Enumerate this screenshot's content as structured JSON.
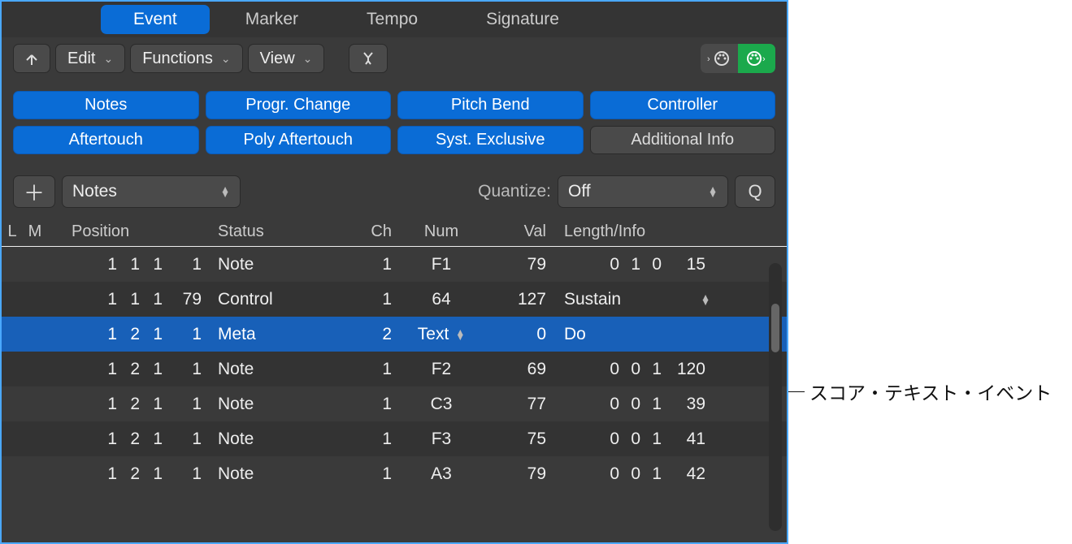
{
  "tabs": {
    "event": "Event",
    "marker": "Marker",
    "tempo": "Tempo",
    "signature": "Signature"
  },
  "toolbar": {
    "edit": "Edit",
    "functions": "Functions",
    "view": "View"
  },
  "filters": {
    "notes": "Notes",
    "progr_change": "Progr. Change",
    "pitch_bend": "Pitch Bend",
    "controller": "Controller",
    "aftertouch": "Aftertouch",
    "poly_aftertouch": "Poly Aftertouch",
    "syst_exclusive": "Syst. Exclusive",
    "additional_info": "Additional Info"
  },
  "control_row": {
    "type_select": "Notes",
    "quantize_label": "Quantize:",
    "quantize_value": "Off",
    "q_button": "Q"
  },
  "columns": {
    "l": "L",
    "m": "M",
    "position": "Position",
    "status": "Status",
    "ch": "Ch",
    "num": "Num",
    "val": "Val",
    "length_info": "Length/Info"
  },
  "rows": [
    {
      "pos": [
        "1",
        "1",
        "1",
        "1"
      ],
      "status": "Note",
      "ch": "1",
      "num": "F1",
      "val": "79",
      "len": [
        "0",
        "1",
        "0",
        "15"
      ],
      "info": "",
      "alt": false,
      "sel": false,
      "num_pop": false,
      "info_pop": false
    },
    {
      "pos": [
        "1",
        "1",
        "1",
        "79"
      ],
      "status": "Control",
      "ch": "1",
      "num": "64",
      "val": "127",
      "len": [],
      "info": "Sustain",
      "alt": true,
      "sel": false,
      "num_pop": false,
      "info_pop": true
    },
    {
      "pos": [
        "1",
        "2",
        "1",
        "1"
      ],
      "status": "Meta",
      "ch": "2",
      "num": "Text",
      "val": "0",
      "len": [],
      "info": "Do",
      "alt": false,
      "sel": true,
      "num_pop": true,
      "info_pop": false
    },
    {
      "pos": [
        "1",
        "2",
        "1",
        "1"
      ],
      "status": "Note",
      "ch": "1",
      "num": "F2",
      "val": "69",
      "len": [
        "0",
        "0",
        "1",
        "120"
      ],
      "info": "",
      "alt": true,
      "sel": false,
      "num_pop": false,
      "info_pop": false
    },
    {
      "pos": [
        "1",
        "2",
        "1",
        "1"
      ],
      "status": "Note",
      "ch": "1",
      "num": "C3",
      "val": "77",
      "len": [
        "0",
        "0",
        "1",
        "39"
      ],
      "info": "",
      "alt": false,
      "sel": false,
      "num_pop": false,
      "info_pop": false
    },
    {
      "pos": [
        "1",
        "2",
        "1",
        "1"
      ],
      "status": "Note",
      "ch": "1",
      "num": "F3",
      "val": "75",
      "len": [
        "0",
        "0",
        "1",
        "41"
      ],
      "info": "",
      "alt": true,
      "sel": false,
      "num_pop": false,
      "info_pop": false
    },
    {
      "pos": [
        "1",
        "2",
        "1",
        "1"
      ],
      "status": "Note",
      "ch": "1",
      "num": "A3",
      "val": "79",
      "len": [
        "0",
        "0",
        "1",
        "42"
      ],
      "info": "",
      "alt": false,
      "sel": false,
      "num_pop": false,
      "info_pop": false
    }
  ],
  "callout": "スコア・テキスト・イベント"
}
